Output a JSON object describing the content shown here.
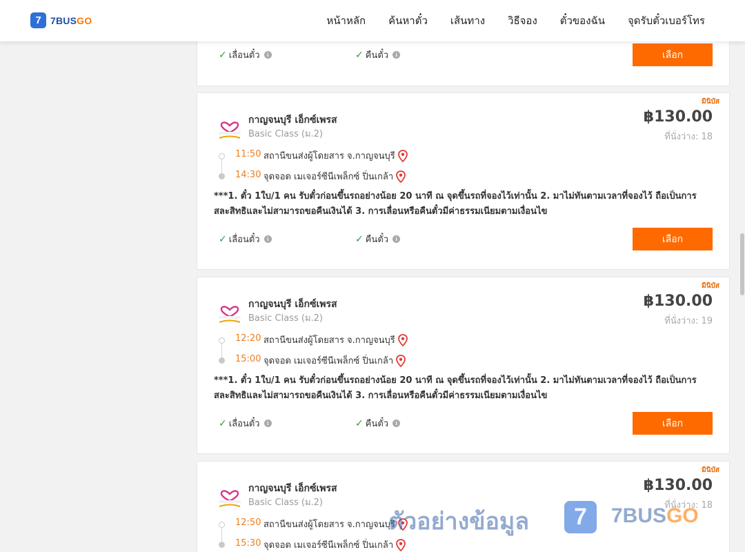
{
  "header": {
    "logo_text": "7BUSGO",
    "nav": [
      "หน้าหลัก",
      "ค้นหาตั๋ว",
      "เส้นทาง",
      "วิธีจอง",
      "ตั๋วของฉัน",
      "จุดรับตั๋วเบอร์โทร"
    ]
  },
  "features": {
    "reschedule": "เลื่อนตั๋ว",
    "refund": "คืนตั๋ว",
    "info_glyph": "i"
  },
  "select_label": "เลือก",
  "trips": [
    {
      "tag": "มินิบัส",
      "operator": "กาญจนบุรี เอ็กซ์เพรส",
      "class": "Basic Class (ม.2)",
      "price": "฿130.00",
      "seats": "ที่นั่งว่าง: 18",
      "dep_time": "11:50",
      "dep_place": "สถานีขนส่งผู้โดยสาร จ.กาญจนบุรี",
      "arr_time": "14:30",
      "arr_place": "จุดจอด เมเจอร์ซีนีเพล็กซ์ ปิ่นเกล้า",
      "note": "***1. ตั๋ว 1ใบ/1 คน รับตั๋วก่อนขึ้นรถอย่างน้อย 20 นาที ณ จุดขึ้นรถที่จองไว้เท่านั้น 2. มาไม่ทันตามเวลาที่จองไว้ ถือเป็นการสละสิทธิและไม่สามารถขอคืนเงินได้ 3. การเลื่อนหรือคืนตั๋วมีค่าธรรมเนียมตามเงื่อนไข"
    },
    {
      "tag": "มินิบัส",
      "operator": "กาญจนบุรี เอ็กซ์เพรส",
      "class": "Basic Class (ม.2)",
      "price": "฿130.00",
      "seats": "ที่นั่งว่าง: 19",
      "dep_time": "12:20",
      "dep_place": "สถานีขนส่งผู้โดยสาร จ.กาญจนบุรี",
      "arr_time": "15:00",
      "arr_place": "จุดจอด เมเจอร์ซีนีเพล็กซ์ ปิ่นเกล้า",
      "note": "***1. ตั๋ว 1ใบ/1 คน รับตั๋วก่อนขึ้นรถอย่างน้อย 20 นาที ณ จุดขึ้นรถที่จองไว้เท่านั้น 2. มาไม่ทันตามเวลาที่จองไว้ ถือเป็นการสละสิทธิและไม่สามารถขอคืนเงินได้ 3. การเลื่อนหรือคืนตั๋วมีค่าธรรมเนียมตามเงื่อนไข"
    },
    {
      "tag": "มินิบัส",
      "operator": "กาญจนบุรี เอ็กซ์เพรส",
      "class": "Basic Class (ม.2)",
      "price": "฿130.00",
      "seats": "ที่นั่งว่าง: 18",
      "dep_time": "12:50",
      "dep_place": "สถานีขนส่งผู้โดยสาร จ.กาญจนบุรี",
      "arr_time": "15:30",
      "arr_place": "จุดจอด เมเจอร์ซีนีเพล็กซ์ ปิ่นเกล้า"
    }
  ],
  "watermark": {
    "text": "ตัวอย่างข้อมูล",
    "logo_glyph": "7",
    "brand": "7BUSGO"
  },
  "colors": {
    "accent": "#ff6a00",
    "time": "#ef7d1a",
    "brand_blue": "#2f6fd8",
    "pin": "#e53935"
  }
}
